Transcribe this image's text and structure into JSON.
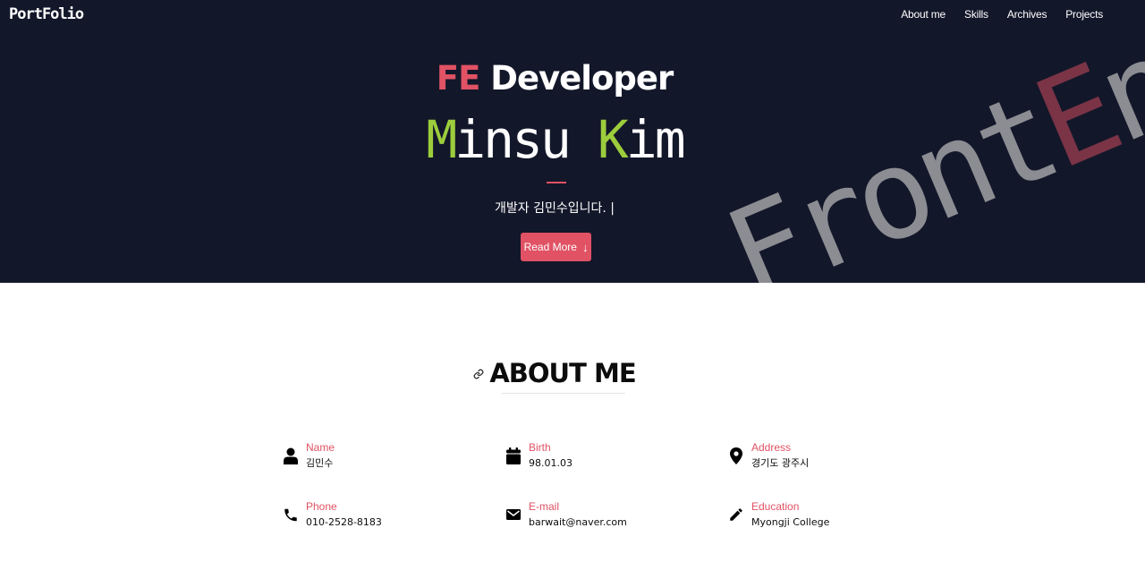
{
  "header": {
    "brand": "PortFolio",
    "nav": [
      "About me",
      "Skills",
      "Archives",
      "Projects"
    ]
  },
  "hero": {
    "title_accent": "FE",
    "title_rest": " Developer",
    "name_hl1": "M",
    "name_mid": "insu ",
    "name_hl2": "K",
    "name_end": "im",
    "subtitle": "개발자 김민수입니다. |",
    "button_label": "Read More",
    "button_icon": "arrow-down-icon",
    "decor_start": "Front",
    "decor_hl": "E",
    "decor_end": "nd"
  },
  "about": {
    "title": "ABOUT ME",
    "title_icon": "link-icon",
    "items": [
      {
        "icon": "user-icon",
        "label": "Name",
        "value": "김민수"
      },
      {
        "icon": "calendar-icon",
        "label": "Birth",
        "value": "98.01.03"
      },
      {
        "icon": "map-marker-icon",
        "label": "Address",
        "value": "경기도 광주시"
      },
      {
        "icon": "phone-icon",
        "label": "Phone",
        "value": "010-2528-8183"
      },
      {
        "icon": "envelope-icon",
        "label": "E-mail",
        "value": "barwait@naver.com"
      },
      {
        "icon": "pencil-icon",
        "label": "Education",
        "value": "Myongji College"
      }
    ]
  },
  "colors": {
    "hero_bg": "#13172a",
    "accent": "#e05264",
    "name_highlight": "#9ccd3c"
  }
}
